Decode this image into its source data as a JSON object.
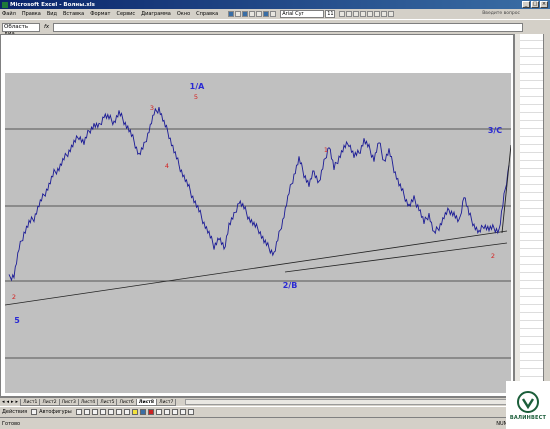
{
  "window": {
    "title": "Microsoft Excel - Волны.xls",
    "buttons": [
      "_",
      "□",
      "×"
    ]
  },
  "menu": {
    "items": [
      "Файл",
      "Правка",
      "Вид",
      "Вставка",
      "Формат",
      "Сервис",
      "Диаграмма",
      "Окно",
      "Справка"
    ],
    "font_name": "Arial Cyr",
    "font_size": "11",
    "help_placeholder": "Введите вопрос"
  },
  "formula": {
    "namebox": "Область диа...",
    "fx": "fx"
  },
  "chart_data": {
    "type": "line",
    "title": "",
    "xlabel": "",
    "ylabel": "",
    "series": [
      {
        "values": [
          205,
          202,
          176,
          160,
          150,
          145,
          132,
          122,
          112,
          100,
          95,
          86,
          78,
          70,
          63,
          70,
          58,
          52,
          54,
          42,
          45,
          49,
          40,
          48,
          57,
          68,
          82,
          73,
          57,
          41,
          35,
          50,
          62,
          78,
          92,
          104,
          115,
          127,
          138,
          150,
          161,
          173,
          165,
          176,
          152,
          143,
          128,
          135,
          145,
          152,
          157,
          168,
          175,
          181,
          162,
          142,
          120,
          102,
          86,
          101,
          112,
          98,
          110,
          90,
          72,
          96,
          84,
          75,
          70,
          83,
          80,
          67,
          75,
          86,
          69,
          88,
          78,
          96,
          111,
          122,
          133,
          126,
          135,
          150,
          141,
          161,
          154,
          144,
          137,
          141,
          150,
          122,
          141,
          152,
          160,
          152,
          156,
          155,
          158,
          124,
          92
        ],
        "color": "#1c1c96"
      }
    ],
    "wave_labels": {
      "blue": [
        "1/A",
        "2/B",
        "3/C",
        "5"
      ],
      "red": [
        "1",
        "2",
        "3",
        "4",
        "5",
        "2"
      ]
    },
    "trendlines": 2,
    "horizontal_levels": 5,
    "grid": false
  },
  "tabs": {
    "nav": [
      "◂",
      "◂",
      "▸",
      "▸"
    ],
    "sheets": [
      "Лист1",
      "Лист2",
      "Лист3",
      "Лист4",
      "Лист5",
      "Лист6",
      "Лист8",
      "Лист7"
    ],
    "active": "Лист8"
  },
  "drawbar": {
    "actions": "Действия",
    "autoshapes": "Автофигуры"
  },
  "status": {
    "left": "Готово",
    "right": "NUM"
  },
  "logo": {
    "text": "ВАЛИНВЕСТ"
  }
}
